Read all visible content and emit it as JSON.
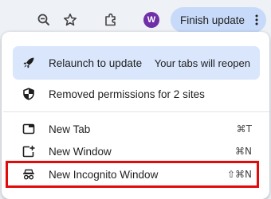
{
  "toolbar": {
    "zoom_icon": "zoom-out-icon",
    "bookmark_icon": "star-icon",
    "extensions_icon": "puzzle-icon",
    "avatar_letter": "W",
    "finish_update_label": "Finish update",
    "menu_icon": "kebab-menu-icon"
  },
  "menu": {
    "update": {
      "label": "Relaunch to update",
      "note": "Your tabs will reopen",
      "icon": "rocket-icon"
    },
    "permissions": {
      "label": "Removed permissions for 2 sites",
      "icon": "shield-icon"
    },
    "items": [
      {
        "label": "New Tab",
        "shortcut": "⌘T",
        "icon": "new-tab-icon"
      },
      {
        "label": "New Window",
        "shortcut": "⌘N",
        "icon": "new-window-icon"
      },
      {
        "label": "New Incognito Window",
        "shortcut": "⇧⌘N",
        "icon": "incognito-icon"
      }
    ]
  },
  "colors": {
    "update_bg": "#d9e6fb",
    "finish_button_bg": "#c7daf9",
    "avatar_bg": "#6f2fa6",
    "highlight": "#e30a0a"
  }
}
